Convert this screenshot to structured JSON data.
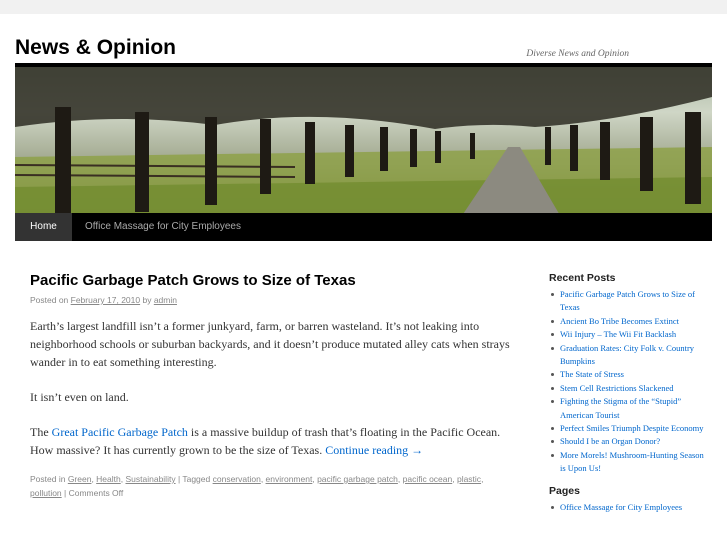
{
  "site": {
    "title": "News & Opinion",
    "description": "Diverse News and Opinion"
  },
  "nav": {
    "home": "Home",
    "item2": "Office Massage for City Employees"
  },
  "post": {
    "title": "Pacific Garbage Patch Grows to Size of Texas",
    "meta_prefix": "Posted on ",
    "date": "February 17, 2010",
    "meta_by": " by ",
    "author": "admin",
    "p1": "Earth’s largest landfill isn’t a former junkyard, farm, or barren wasteland. It’s not leaking into neighborhood schools or suburban backyards, and it doesn’t produce mutated alley cats when strays wander in to eat something interesting.",
    "p2": "It isn’t even on land.",
    "p3_before": "The ",
    "p3_link": "Great Pacific Garbage Patch",
    "p3_after": " is a massive buildup of trash that’s floating in the Pacific Ocean. How massive? It has currently grown to be the size of Texas. ",
    "continue": "Continue reading →",
    "util": {
      "posted_in": "Posted in ",
      "categories": [
        "Green",
        "Health",
        "Sustainability"
      ],
      "tagged": " | Tagged ",
      "tags": [
        "conservation",
        "environment",
        "pacific garbage patch",
        "pacific ocean",
        "plastic",
        "pollution"
      ],
      "comments": " | Comments Off"
    }
  },
  "sidebar": {
    "recent_title": "Recent Posts",
    "recent": [
      "Pacific Garbage Patch Grows to Size of Texas",
      "Ancient Bo Tribe Becomes Extinct",
      "Wii Injury – The Wii Fit Backlash",
      "Graduation Rates: City Folk v. Country Bumpkins",
      "The State of Stress",
      "Stem Cell Restrictions Slackened",
      "Fighting the Stigma of the “Stupid” American Tourist",
      "Perfect Smiles Triumph Despite Economy",
      "Should I be an Organ Donor?",
      "More Morels! Mushroom-Hunting Season is Upon Us!"
    ],
    "pages_title": "Pages",
    "pages": [
      "Office Massage for City Employees"
    ]
  }
}
